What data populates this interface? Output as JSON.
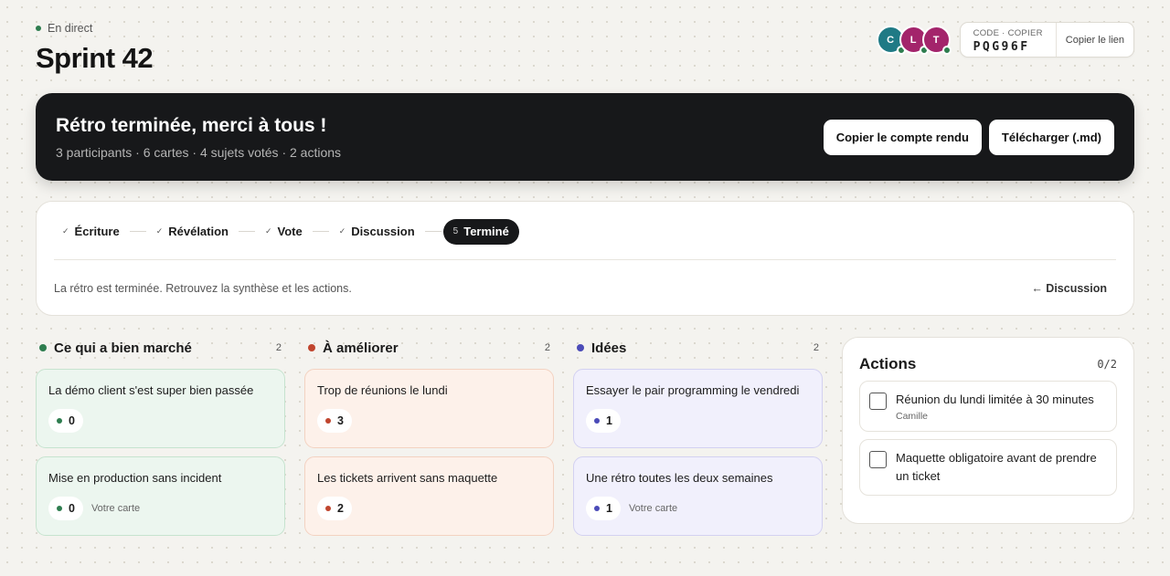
{
  "session": {
    "status": "En direct",
    "title": "Sprint 42",
    "code_label": "CODE · COPIER",
    "code": "PQG96F",
    "copy_link": "Copier le lien"
  },
  "participants": [
    {
      "initial": "C",
      "color": "#1f7a85"
    },
    {
      "initial": "L",
      "color": "#a3246b"
    },
    {
      "initial": "T",
      "color": "#a3246b"
    }
  ],
  "banner": {
    "title": "Rétro terminée, merci à tous !",
    "summary": "3 participants · 6 cartes · 4 sujets votés · 2 actions",
    "copy_report": "Copier le compte rendu",
    "download": "Télécharger (.md)"
  },
  "steps": {
    "check": "✓",
    "items": [
      "Écriture",
      "Révélation",
      "Vote",
      "Discussion"
    ],
    "active_num": "5",
    "active_label": "Terminé",
    "message": "La rétro est terminée. Retrouvez la synthèse et les actions.",
    "back": "← Discussion"
  },
  "columns": [
    {
      "name": "Ce qui a bien marché",
      "count": "2",
      "accent": "#2e7d4f",
      "bg": "#ecf6ef",
      "border": "#c6e3cf",
      "cards": [
        {
          "text": "La démo client s'est super bien passée",
          "votes": "0",
          "note": ""
        },
        {
          "text": "Mise en production sans incident",
          "votes": "0",
          "note": "Votre carte"
        }
      ]
    },
    {
      "name": "À améliorer",
      "count": "2",
      "accent": "#c0452e",
      "bg": "#fdf1ea",
      "border": "#f3d2c1",
      "cards": [
        {
          "text": "Trop de réunions le lundi",
          "votes": "3",
          "note": ""
        },
        {
          "text": "Les tickets arrivent sans maquette",
          "votes": "2",
          "note": ""
        }
      ]
    },
    {
      "name": "Idées",
      "count": "2",
      "accent": "#4b4bb8",
      "bg": "#f1f0fc",
      "border": "#d3d1f1",
      "cards": [
        {
          "text": "Essayer le pair programming le vendredi",
          "votes": "1",
          "note": ""
        },
        {
          "text": "Une rétro toutes les deux semaines",
          "votes": "1",
          "note": "Votre carte"
        }
      ]
    }
  ],
  "actions": {
    "title": "Actions",
    "ratio": "0/2",
    "items": [
      {
        "text": "Réunion du lundi limitée à 30 minutes",
        "owner": "Camille"
      },
      {
        "text": "Maquette obligatoire avant de prendre un ticket",
        "owner": ""
      }
    ]
  }
}
